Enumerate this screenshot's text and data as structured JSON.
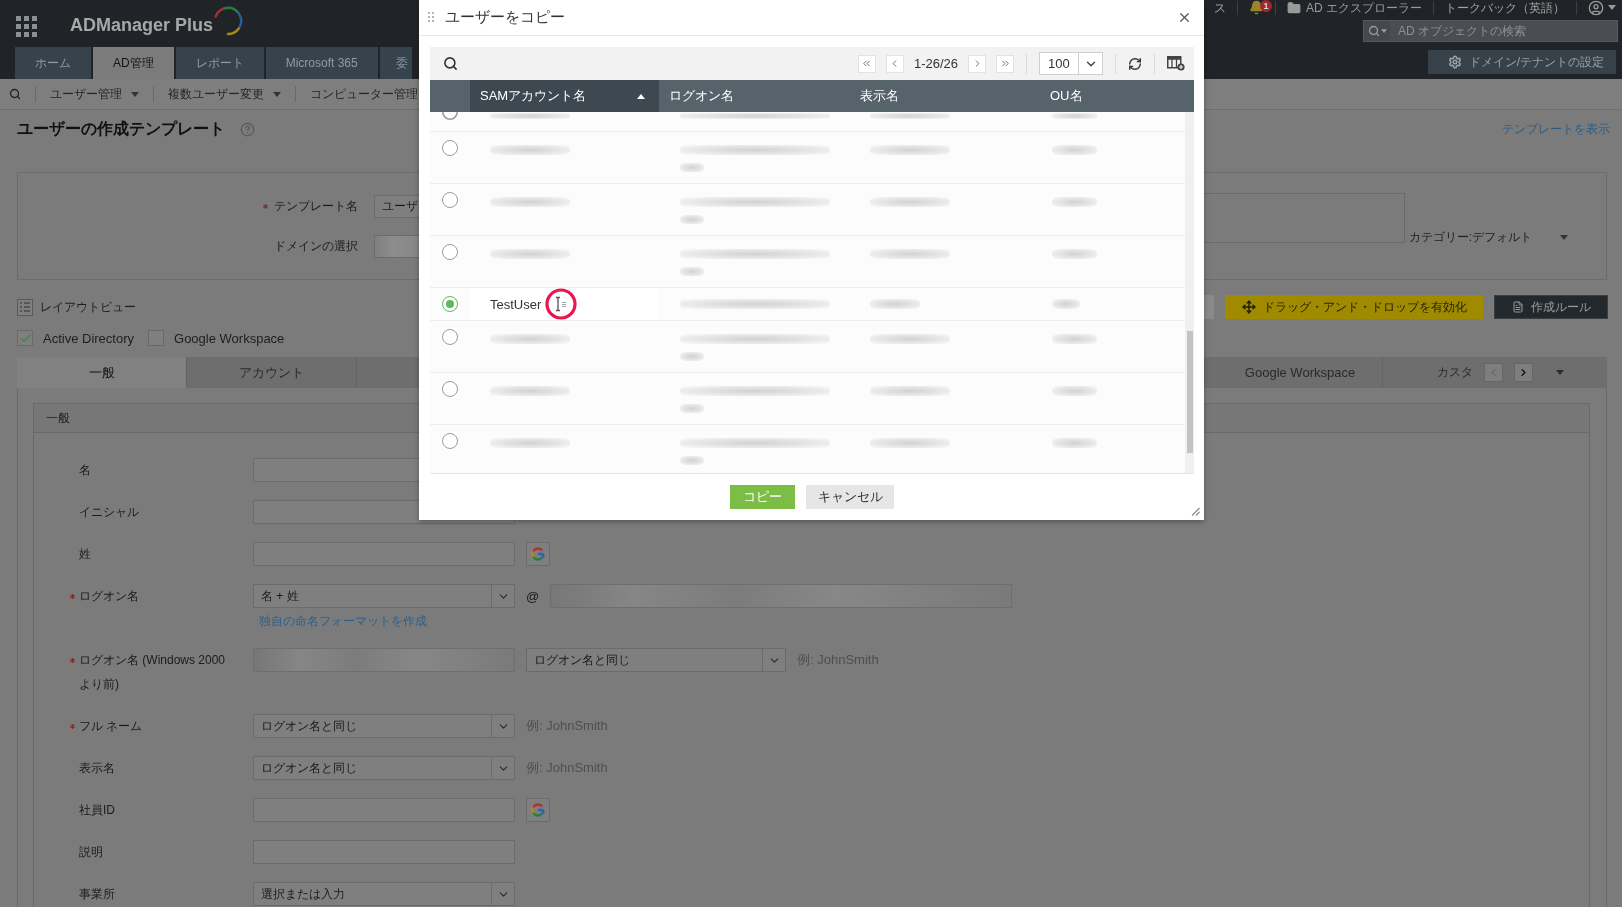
{
  "header": {
    "logo": "ADManager Plus",
    "top_links": [
      {
        "kind": "text",
        "label": "ス"
      },
      {
        "kind": "notifications",
        "badge": "1"
      },
      {
        "kind": "explorer",
        "label": "AD エクスプローラー"
      },
      {
        "kind": "text",
        "label": "トークバック（英語）"
      },
      {
        "kind": "account"
      }
    ],
    "search": {
      "placeholder": "AD オブジェクトの検索"
    },
    "nav_tabs": [
      {
        "label": "ホーム",
        "selected": false
      },
      {
        "label": "AD管理",
        "selected": true
      },
      {
        "label": "レポート",
        "selected": false
      },
      {
        "label": "Microsoft 365",
        "selected": false
      },
      {
        "label": "委",
        "selected": false
      }
    ],
    "settings_button": "ドメイン/テナントの設定"
  },
  "toolbar": {
    "menus": [
      {
        "label": "ユーザー管理",
        "has_menu": true
      },
      {
        "label": "複数ユーザー変更",
        "has_menu": true
      },
      {
        "label": "コンピューター管理",
        "has_menu": false
      }
    ]
  },
  "page": {
    "title": "ユーザーの作成テンプレート",
    "view_template_link": "テンプレートを表示"
  },
  "template_card": {
    "fields": [
      {
        "label": "テンプレート名",
        "required": true,
        "kind": "input",
        "value": "ユーザ"
      },
      {
        "label": "ドメインの選択",
        "required": false,
        "kind": "redacted"
      }
    ],
    "category": "カテゴリー:デフォルト"
  },
  "layout_view": "レイアウトビュー",
  "targets": [
    {
      "label": "Active Directory",
      "checked": true
    },
    {
      "label": "Google Workspace",
      "checked": false
    }
  ],
  "actions": [
    {
      "kind": "partial"
    },
    {
      "kind": "drag",
      "label": "ドラッグ・アンド・ドロップを有効化"
    },
    {
      "kind": "rules",
      "label": "作成ルール"
    }
  ],
  "tabs": [
    {
      "label": "一般",
      "selected": true
    },
    {
      "label": "アカウント",
      "selected": false
    },
    {
      "label": "Google Workspace",
      "selected": false
    },
    {
      "label": "カスタ",
      "selected": false
    }
  ],
  "section": {
    "title": "一般",
    "fields": [
      {
        "label": "名",
        "required": false,
        "kind": "input"
      },
      {
        "label": "イニシャル",
        "required": false,
        "kind": "input"
      },
      {
        "label": "姓",
        "required": false,
        "kind": "input",
        "extras": [
          {
            "kind": "google"
          }
        ]
      },
      {
        "label": "ログオン名",
        "required": true,
        "kind": "select",
        "value": "名 + 姓",
        "extras": [
          {
            "kind": "text",
            "text": "@"
          },
          {
            "kind": "redacted"
          }
        ],
        "link": "独自の命名フォーマットを作成"
      },
      {
        "label": "ログオン名 (Windows 2000 より前)",
        "required": true,
        "kind": "redacted",
        "extras": [
          {
            "kind": "select",
            "value": "ログオン名と同じ"
          },
          {
            "kind": "hint",
            "text": "例: JohnSmith"
          }
        ]
      },
      {
        "label": "フル ネーム",
        "required": true,
        "kind": "select",
        "value": "ログオン名と同じ",
        "extras": [
          {
            "kind": "hint",
            "text": "例: JohnSmith"
          }
        ]
      },
      {
        "label": "表示名",
        "required": false,
        "kind": "select",
        "value": "ログオン名と同じ",
        "extras": [
          {
            "kind": "hint",
            "text": "例: JohnSmith"
          }
        ]
      },
      {
        "label": "社員ID",
        "required": false,
        "kind": "input",
        "extras": [
          {
            "kind": "google"
          }
        ]
      },
      {
        "label": "説明",
        "required": false,
        "kind": "input"
      },
      {
        "label": "事業所",
        "required": false,
        "kind": "select",
        "value": "選択または入力"
      }
    ]
  },
  "dialog": {
    "title": "ユーザーをコピー",
    "pager": {
      "range": "1-26/26",
      "page_size": "100"
    },
    "columns": [
      {
        "label": "SAMアカウント名",
        "sorted": true
      },
      {
        "label": "ログオン名",
        "sorted": false
      },
      {
        "label": "表示名",
        "sorted": false
      },
      {
        "label": "OU名",
        "sorted": false
      }
    ],
    "rows": [
      {
        "selected": false
      },
      {
        "selected": false
      },
      {
        "selected": false
      },
      {
        "selected": false
      },
      {
        "selected": true,
        "sam_account_name": "TestUser"
      },
      {
        "selected": false
      },
      {
        "selected": false
      },
      {
        "selected": false
      }
    ],
    "buttons": [
      {
        "kind": "primary",
        "label": "コピー"
      },
      {
        "kind": "secondary",
        "label": "キャンセル"
      }
    ]
  }
}
